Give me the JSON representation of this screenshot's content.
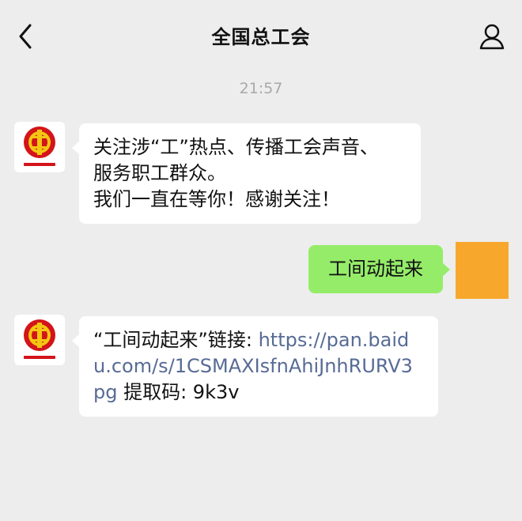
{
  "nav": {
    "title": "全国总工会",
    "back_icon": "chevron-left-icon",
    "profile_icon": "person-icon"
  },
  "timestamp": "21:57",
  "messages": [
    {
      "sender": "official",
      "avatar_icon": "union-logo",
      "lines": [
        "关注涉“工”热点、传播工会声音、",
        "服务职工群众。",
        "我们一直在等你！感谢关注！"
      ]
    },
    {
      "sender": "me",
      "text": "工间动起来"
    },
    {
      "sender": "official",
      "avatar_icon": "union-logo",
      "prefix": "“工间动起来”链接: ",
      "link_part1": "https://pan.baid",
      "link_part2": "u.com/s/1CSMAXIsfnAhiJnhRURV3",
      "link_part3": "pg",
      "suffix": " 提取码: 9k3v"
    }
  ],
  "colors": {
    "background": "#ededed",
    "my_bubble": "#95ec69",
    "link": "#576b95",
    "logo_red": "#d3141a",
    "logo_gold": "#f3c613",
    "my_avatar": "#f7a82c"
  }
}
